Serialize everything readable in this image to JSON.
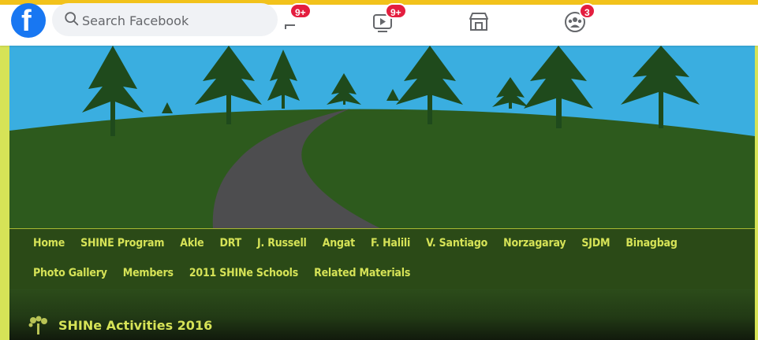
{
  "facebook_bar": {
    "logo": "f",
    "search_placeholder": "Search Facebook",
    "nav": [
      {
        "icon": "flag-icon",
        "badge": "9+"
      },
      {
        "icon": "watch-icon",
        "badge": "9+"
      },
      {
        "icon": "marketplace-icon",
        "badge": ""
      },
      {
        "icon": "groups-icon",
        "badge": "3"
      }
    ]
  },
  "site": {
    "menu_row1": [
      "Home",
      "SHINE Program",
      "Akle",
      "DRT",
      "J. Russell",
      "Angat",
      "F. Halili",
      "V. Santiago",
      "Norzagaray",
      "SJDM",
      "Binagbag"
    ],
    "menu_row2": [
      "Photo Gallery",
      "Members",
      "2011 SHINe Schools",
      "Related Materials"
    ],
    "post_title": "SHINe Activities 2016",
    "title_icon": "tree-icon"
  },
  "colors": {
    "accent_strip": "#f2c21b",
    "facebook_blue": "#1877f2",
    "badge_red": "#e41e3f",
    "site_border": "#d6e357",
    "site_green": "#2c4c1a",
    "menu_text": "#d6e357",
    "sky": "#3aaee0"
  }
}
